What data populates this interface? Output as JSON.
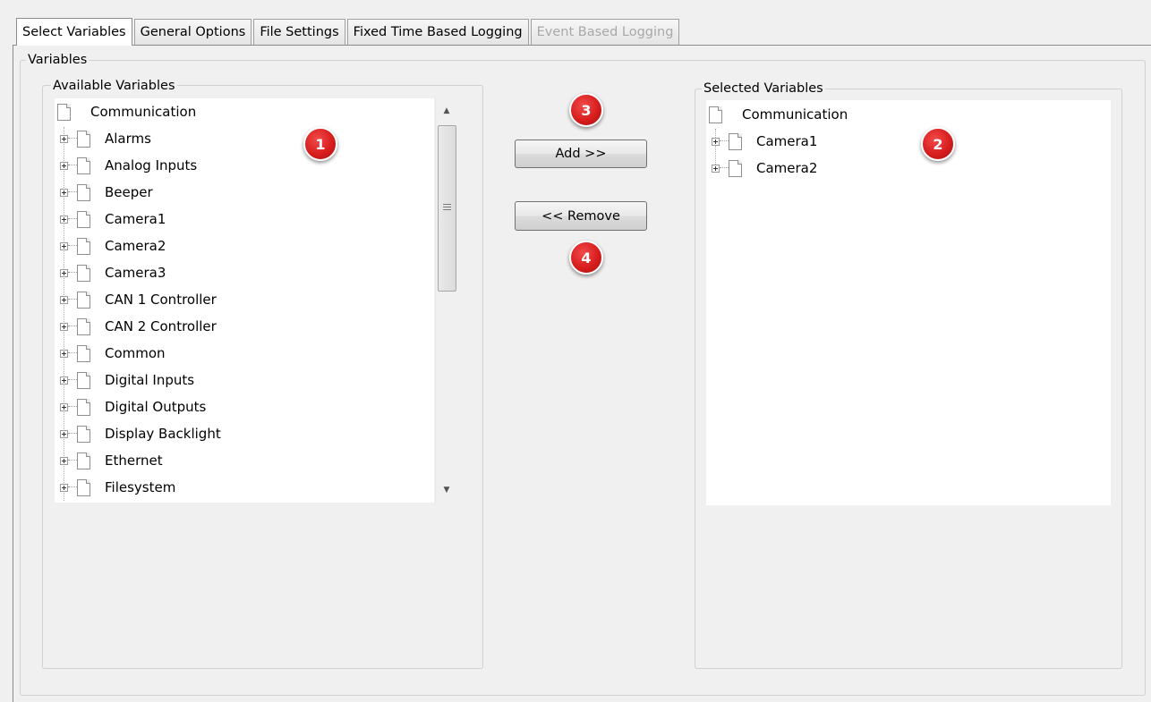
{
  "tabs": [
    {
      "label": "Select Variables",
      "active": true,
      "enabled": true
    },
    {
      "label": "General Options",
      "active": false,
      "enabled": true
    },
    {
      "label": "File Settings",
      "active": false,
      "enabled": true
    },
    {
      "label": "Fixed Time Based Logging",
      "active": false,
      "enabled": true
    },
    {
      "label": "Event Based Logging",
      "active": false,
      "enabled": false
    }
  ],
  "variables_group": {
    "title": "Variables"
  },
  "available": {
    "title": "Available Variables",
    "root": "Communication",
    "items": [
      "Alarms",
      "Analog Inputs",
      "Beeper",
      "Camera1",
      "Camera2",
      "Camera3",
      "CAN 1 Controller",
      "CAN 2 Controller",
      "Common",
      "Digital Inputs",
      "Digital Outputs",
      "Display Backlight",
      "Ethernet",
      "Filesystem"
    ]
  },
  "selected": {
    "title": "Selected Variables",
    "root": "Communication",
    "items": [
      "Camera1",
      "Camera2"
    ]
  },
  "buttons": {
    "add": "Add >>",
    "remove": "<< Remove"
  },
  "markers": [
    "1",
    "2",
    "3",
    "4"
  ],
  "colors": {
    "marker": "#d81e1e",
    "background": "#f0f0f0",
    "list_background": "#ffffff"
  },
  "icons": {
    "tree_item": "document-icon",
    "expander": "plus-box-icon"
  }
}
